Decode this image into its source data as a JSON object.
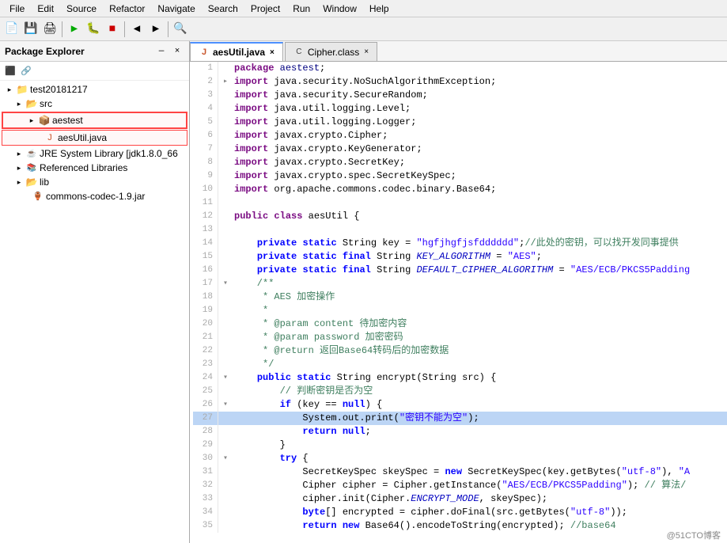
{
  "menubar": {
    "items": [
      "File",
      "Edit",
      "Source",
      "Refactor",
      "Navigate",
      "Search",
      "Project",
      "Run",
      "Window",
      "Help"
    ]
  },
  "sidebar": {
    "title": "Package Explorer",
    "close_icon": "×",
    "minimize_icon": "—",
    "tree": [
      {
        "id": "root",
        "label": "test20181217",
        "indent": 0,
        "arrow": "▸",
        "icon": "project",
        "expanded": true
      },
      {
        "id": "src",
        "label": "src",
        "indent": 1,
        "arrow": "▸",
        "icon": "folder-src",
        "expanded": true
      },
      {
        "id": "aestest",
        "label": "aestest",
        "indent": 2,
        "arrow": "▸",
        "icon": "package",
        "expanded": true,
        "highlighted": true
      },
      {
        "id": "aesutil",
        "label": "aesUtil.java",
        "indent": 3,
        "arrow": "",
        "icon": "java-file"
      },
      {
        "id": "jre",
        "label": "JRE System Library [jdk1.8.0_66",
        "indent": 1,
        "arrow": "▸",
        "icon": "jre-lib"
      },
      {
        "id": "reflibs",
        "label": "Referenced Libraries",
        "indent": 1,
        "arrow": "▸",
        "icon": "ref-lib"
      },
      {
        "id": "lib",
        "label": "lib",
        "indent": 1,
        "arrow": "▸",
        "icon": "folder",
        "expanded": true
      },
      {
        "id": "codec",
        "label": "commons-codec-1.9.jar",
        "indent": 2,
        "arrow": "",
        "icon": "jar-file"
      }
    ]
  },
  "tabs": [
    {
      "label": "aesUtil.java",
      "active": true,
      "icon": "java"
    },
    {
      "label": "Cipher.class",
      "active": false,
      "icon": "class"
    }
  ],
  "code": {
    "lines": [
      {
        "num": 1,
        "marker": "",
        "content": "package aestest;",
        "highlight": false
      },
      {
        "num": 2,
        "marker": "▸",
        "content": "import java.security.NoSuchAlgorithmException;",
        "highlight": false
      },
      {
        "num": 3,
        "marker": "",
        "content": "import java.security.SecureRandom;",
        "highlight": false
      },
      {
        "num": 4,
        "marker": "",
        "content": "import java.util.logging.Level;",
        "highlight": false
      },
      {
        "num": 5,
        "marker": "",
        "content": "import java.util.logging.Logger;",
        "highlight": false
      },
      {
        "num": 6,
        "marker": "",
        "content": "import javax.crypto.Cipher;",
        "highlight": false
      },
      {
        "num": 7,
        "marker": "",
        "content": "import javax.crypto.KeyGenerator;",
        "highlight": false
      },
      {
        "num": 8,
        "marker": "",
        "content": "import javax.crypto.SecretKey;",
        "highlight": false
      },
      {
        "num": 9,
        "marker": "",
        "content": "import javax.crypto.spec.SecretKeySpec;",
        "highlight": false
      },
      {
        "num": 10,
        "marker": "",
        "content": "import org.apache.commons.codec.binary.Base64;",
        "highlight": false
      },
      {
        "num": 11,
        "marker": "",
        "content": "",
        "highlight": false
      },
      {
        "num": 12,
        "marker": "",
        "content": "public class aesUtil {",
        "highlight": false
      },
      {
        "num": 13,
        "marker": "",
        "content": "",
        "highlight": false
      },
      {
        "num": 14,
        "marker": "",
        "content": "    private static String key = \"hgfjhgfjsfdddddd\";//此处的密钥，可以找开发同事提供",
        "highlight": false
      },
      {
        "num": 15,
        "marker": "",
        "content": "    private static final String KEY_ALGORITHM = \"AES\";",
        "highlight": false
      },
      {
        "num": 16,
        "marker": "",
        "content": "    private static final String DEFAULT_CIPHER_ALGORITHM = \"AES/ECB/PKCS5Padding",
        "highlight": false
      },
      {
        "num": 17,
        "marker": "▾",
        "content": "    /**",
        "highlight": false
      },
      {
        "num": 18,
        "marker": "",
        "content": "     * AES 加密操作",
        "highlight": false
      },
      {
        "num": 19,
        "marker": "",
        "content": "     *",
        "highlight": false
      },
      {
        "num": 20,
        "marker": "",
        "content": "     * @param content 待加密内容",
        "highlight": false
      },
      {
        "num": 21,
        "marker": "",
        "content": "     * @param password 加密密码",
        "highlight": false
      },
      {
        "num": 22,
        "marker": "",
        "content": "     * @return 返回Base64转码后的加密数据",
        "highlight": false
      },
      {
        "num": 23,
        "marker": "",
        "content": "     */",
        "highlight": false
      },
      {
        "num": 24,
        "marker": "▾",
        "content": "    public static String encrypt(String src) {",
        "highlight": false
      },
      {
        "num": 25,
        "marker": "",
        "content": "        // 判断密钥是否为空",
        "highlight": false
      },
      {
        "num": 26,
        "marker": "▾",
        "content": "        if (key == null) {",
        "highlight": false
      },
      {
        "num": 27,
        "marker": "",
        "content": "            System.out.print(\"密钥不能为空\");",
        "highlight": true
      },
      {
        "num": 28,
        "marker": "",
        "content": "            return null;",
        "highlight": false
      },
      {
        "num": 29,
        "marker": "",
        "content": "        }",
        "highlight": false
      },
      {
        "num": 30,
        "marker": "▾",
        "content": "        try {",
        "highlight": false
      },
      {
        "num": 31,
        "marker": "",
        "content": "            SecretKeySpec skeySpec = new SecretKeySpec(key.getBytes(\"utf-8\"), \"A",
        "highlight": false
      },
      {
        "num": 32,
        "marker": "",
        "content": "            Cipher cipher = Cipher.getInstance(\"AES/ECB/PKCS5Padding\"); // 算法/",
        "highlight": false
      },
      {
        "num": 33,
        "marker": "",
        "content": "            cipher.init(Cipher.ENCRYPT_MODE, skeySpec);",
        "highlight": false
      },
      {
        "num": 34,
        "marker": "",
        "content": "            byte[] encrypted = cipher.doFinal(src.getBytes(\"utf-8\"));",
        "highlight": false
      },
      {
        "num": 35,
        "marker": "",
        "content": "            return new Base64().encodeToString(encrypted); //base64",
        "highlight": false
      }
    ]
  },
  "watermark": "@51CTO博客"
}
